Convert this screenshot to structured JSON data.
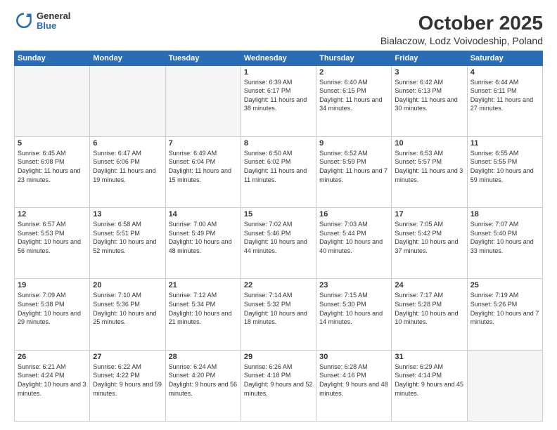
{
  "logo": {
    "general": "General",
    "blue": "Blue"
  },
  "header": {
    "title": "October 2025",
    "subtitle": "Bialaczow, Lodz Voivodeship, Poland"
  },
  "weekdays": [
    "Sunday",
    "Monday",
    "Tuesday",
    "Wednesday",
    "Thursday",
    "Friday",
    "Saturday"
  ],
  "weeks": [
    [
      {
        "day": "",
        "info": ""
      },
      {
        "day": "",
        "info": ""
      },
      {
        "day": "",
        "info": ""
      },
      {
        "day": "1",
        "info": "Sunrise: 6:39 AM\nSunset: 6:17 PM\nDaylight: 11 hours\nand 38 minutes."
      },
      {
        "day": "2",
        "info": "Sunrise: 6:40 AM\nSunset: 6:15 PM\nDaylight: 11 hours\nand 34 minutes."
      },
      {
        "day": "3",
        "info": "Sunrise: 6:42 AM\nSunset: 6:13 PM\nDaylight: 11 hours\nand 30 minutes."
      },
      {
        "day": "4",
        "info": "Sunrise: 6:44 AM\nSunset: 6:11 PM\nDaylight: 11 hours\nand 27 minutes."
      }
    ],
    [
      {
        "day": "5",
        "info": "Sunrise: 6:45 AM\nSunset: 6:08 PM\nDaylight: 11 hours\nand 23 minutes."
      },
      {
        "day": "6",
        "info": "Sunrise: 6:47 AM\nSunset: 6:06 PM\nDaylight: 11 hours\nand 19 minutes."
      },
      {
        "day": "7",
        "info": "Sunrise: 6:49 AM\nSunset: 6:04 PM\nDaylight: 11 hours\nand 15 minutes."
      },
      {
        "day": "8",
        "info": "Sunrise: 6:50 AM\nSunset: 6:02 PM\nDaylight: 11 hours\nand 11 minutes."
      },
      {
        "day": "9",
        "info": "Sunrise: 6:52 AM\nSunset: 5:59 PM\nDaylight: 11 hours\nand 7 minutes."
      },
      {
        "day": "10",
        "info": "Sunrise: 6:53 AM\nSunset: 5:57 PM\nDaylight: 11 hours\nand 3 minutes."
      },
      {
        "day": "11",
        "info": "Sunrise: 6:55 AM\nSunset: 5:55 PM\nDaylight: 10 hours\nand 59 minutes."
      }
    ],
    [
      {
        "day": "12",
        "info": "Sunrise: 6:57 AM\nSunset: 5:53 PM\nDaylight: 10 hours\nand 56 minutes."
      },
      {
        "day": "13",
        "info": "Sunrise: 6:58 AM\nSunset: 5:51 PM\nDaylight: 10 hours\nand 52 minutes."
      },
      {
        "day": "14",
        "info": "Sunrise: 7:00 AM\nSunset: 5:49 PM\nDaylight: 10 hours\nand 48 minutes."
      },
      {
        "day": "15",
        "info": "Sunrise: 7:02 AM\nSunset: 5:46 PM\nDaylight: 10 hours\nand 44 minutes."
      },
      {
        "day": "16",
        "info": "Sunrise: 7:03 AM\nSunset: 5:44 PM\nDaylight: 10 hours\nand 40 minutes."
      },
      {
        "day": "17",
        "info": "Sunrise: 7:05 AM\nSunset: 5:42 PM\nDaylight: 10 hours\nand 37 minutes."
      },
      {
        "day": "18",
        "info": "Sunrise: 7:07 AM\nSunset: 5:40 PM\nDaylight: 10 hours\nand 33 minutes."
      }
    ],
    [
      {
        "day": "19",
        "info": "Sunrise: 7:09 AM\nSunset: 5:38 PM\nDaylight: 10 hours\nand 29 minutes."
      },
      {
        "day": "20",
        "info": "Sunrise: 7:10 AM\nSunset: 5:36 PM\nDaylight: 10 hours\nand 25 minutes."
      },
      {
        "day": "21",
        "info": "Sunrise: 7:12 AM\nSunset: 5:34 PM\nDaylight: 10 hours\nand 21 minutes."
      },
      {
        "day": "22",
        "info": "Sunrise: 7:14 AM\nSunset: 5:32 PM\nDaylight: 10 hours\nand 18 minutes."
      },
      {
        "day": "23",
        "info": "Sunrise: 7:15 AM\nSunset: 5:30 PM\nDaylight: 10 hours\nand 14 minutes."
      },
      {
        "day": "24",
        "info": "Sunrise: 7:17 AM\nSunset: 5:28 PM\nDaylight: 10 hours\nand 10 minutes."
      },
      {
        "day": "25",
        "info": "Sunrise: 7:19 AM\nSunset: 5:26 PM\nDaylight: 10 hours\nand 7 minutes."
      }
    ],
    [
      {
        "day": "26",
        "info": "Sunrise: 6:21 AM\nSunset: 4:24 PM\nDaylight: 10 hours\nand 3 minutes."
      },
      {
        "day": "27",
        "info": "Sunrise: 6:22 AM\nSunset: 4:22 PM\nDaylight: 9 hours\nand 59 minutes."
      },
      {
        "day": "28",
        "info": "Sunrise: 6:24 AM\nSunset: 4:20 PM\nDaylight: 9 hours\nand 56 minutes."
      },
      {
        "day": "29",
        "info": "Sunrise: 6:26 AM\nSunset: 4:18 PM\nDaylight: 9 hours\nand 52 minutes."
      },
      {
        "day": "30",
        "info": "Sunrise: 6:28 AM\nSunset: 4:16 PM\nDaylight: 9 hours\nand 48 minutes."
      },
      {
        "day": "31",
        "info": "Sunrise: 6:29 AM\nSunset: 4:14 PM\nDaylight: 9 hours\nand 45 minutes."
      },
      {
        "day": "",
        "info": ""
      }
    ]
  ]
}
